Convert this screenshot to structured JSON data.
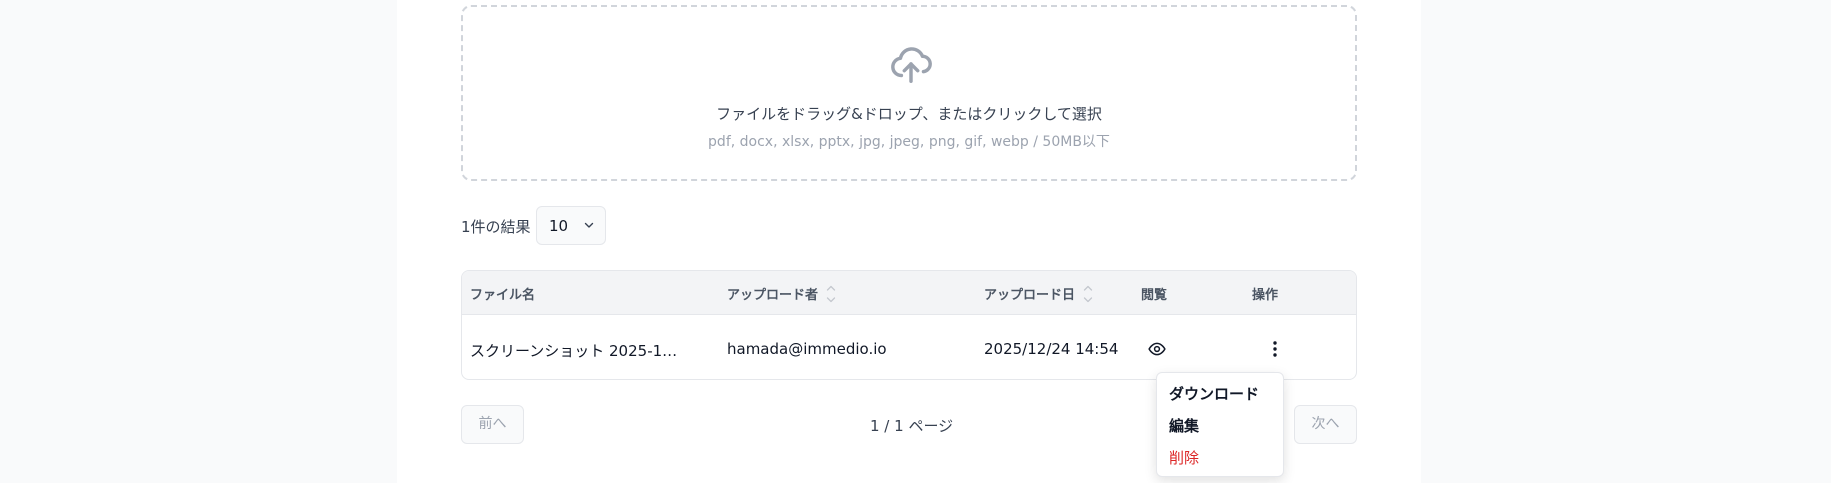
{
  "upload": {
    "icon": "cloud-upload-icon",
    "main_text": "ファイルをドラッグ&ドロップ、またはクリックして選択",
    "sub_text": "pdf, docx, xlsx, pptx, jpg, jpeg, png, gif, webp / 50MB以下"
  },
  "results": {
    "count_text": "1件の結果",
    "page_size": "10"
  },
  "table": {
    "columns": [
      "ファイル名",
      "アップロード者",
      "アップロード日",
      "閲覧",
      "操作"
    ],
    "rows": [
      {
        "file_name": "スクリーンショット 2025-1…",
        "uploader": "hamada@immedio.io",
        "uploaded_at": "2025/12/24 14:54"
      }
    ]
  },
  "pagination": {
    "prev_label": "前へ",
    "page_info": "1 / 1 ページ",
    "next_label": "次へ"
  },
  "context_menu": {
    "items": [
      "ダウンロード",
      "編集",
      "削除"
    ]
  },
  "colors": {
    "danger": "#dc2626",
    "muted": "#9ca3af",
    "border": "#e5e7eb"
  }
}
